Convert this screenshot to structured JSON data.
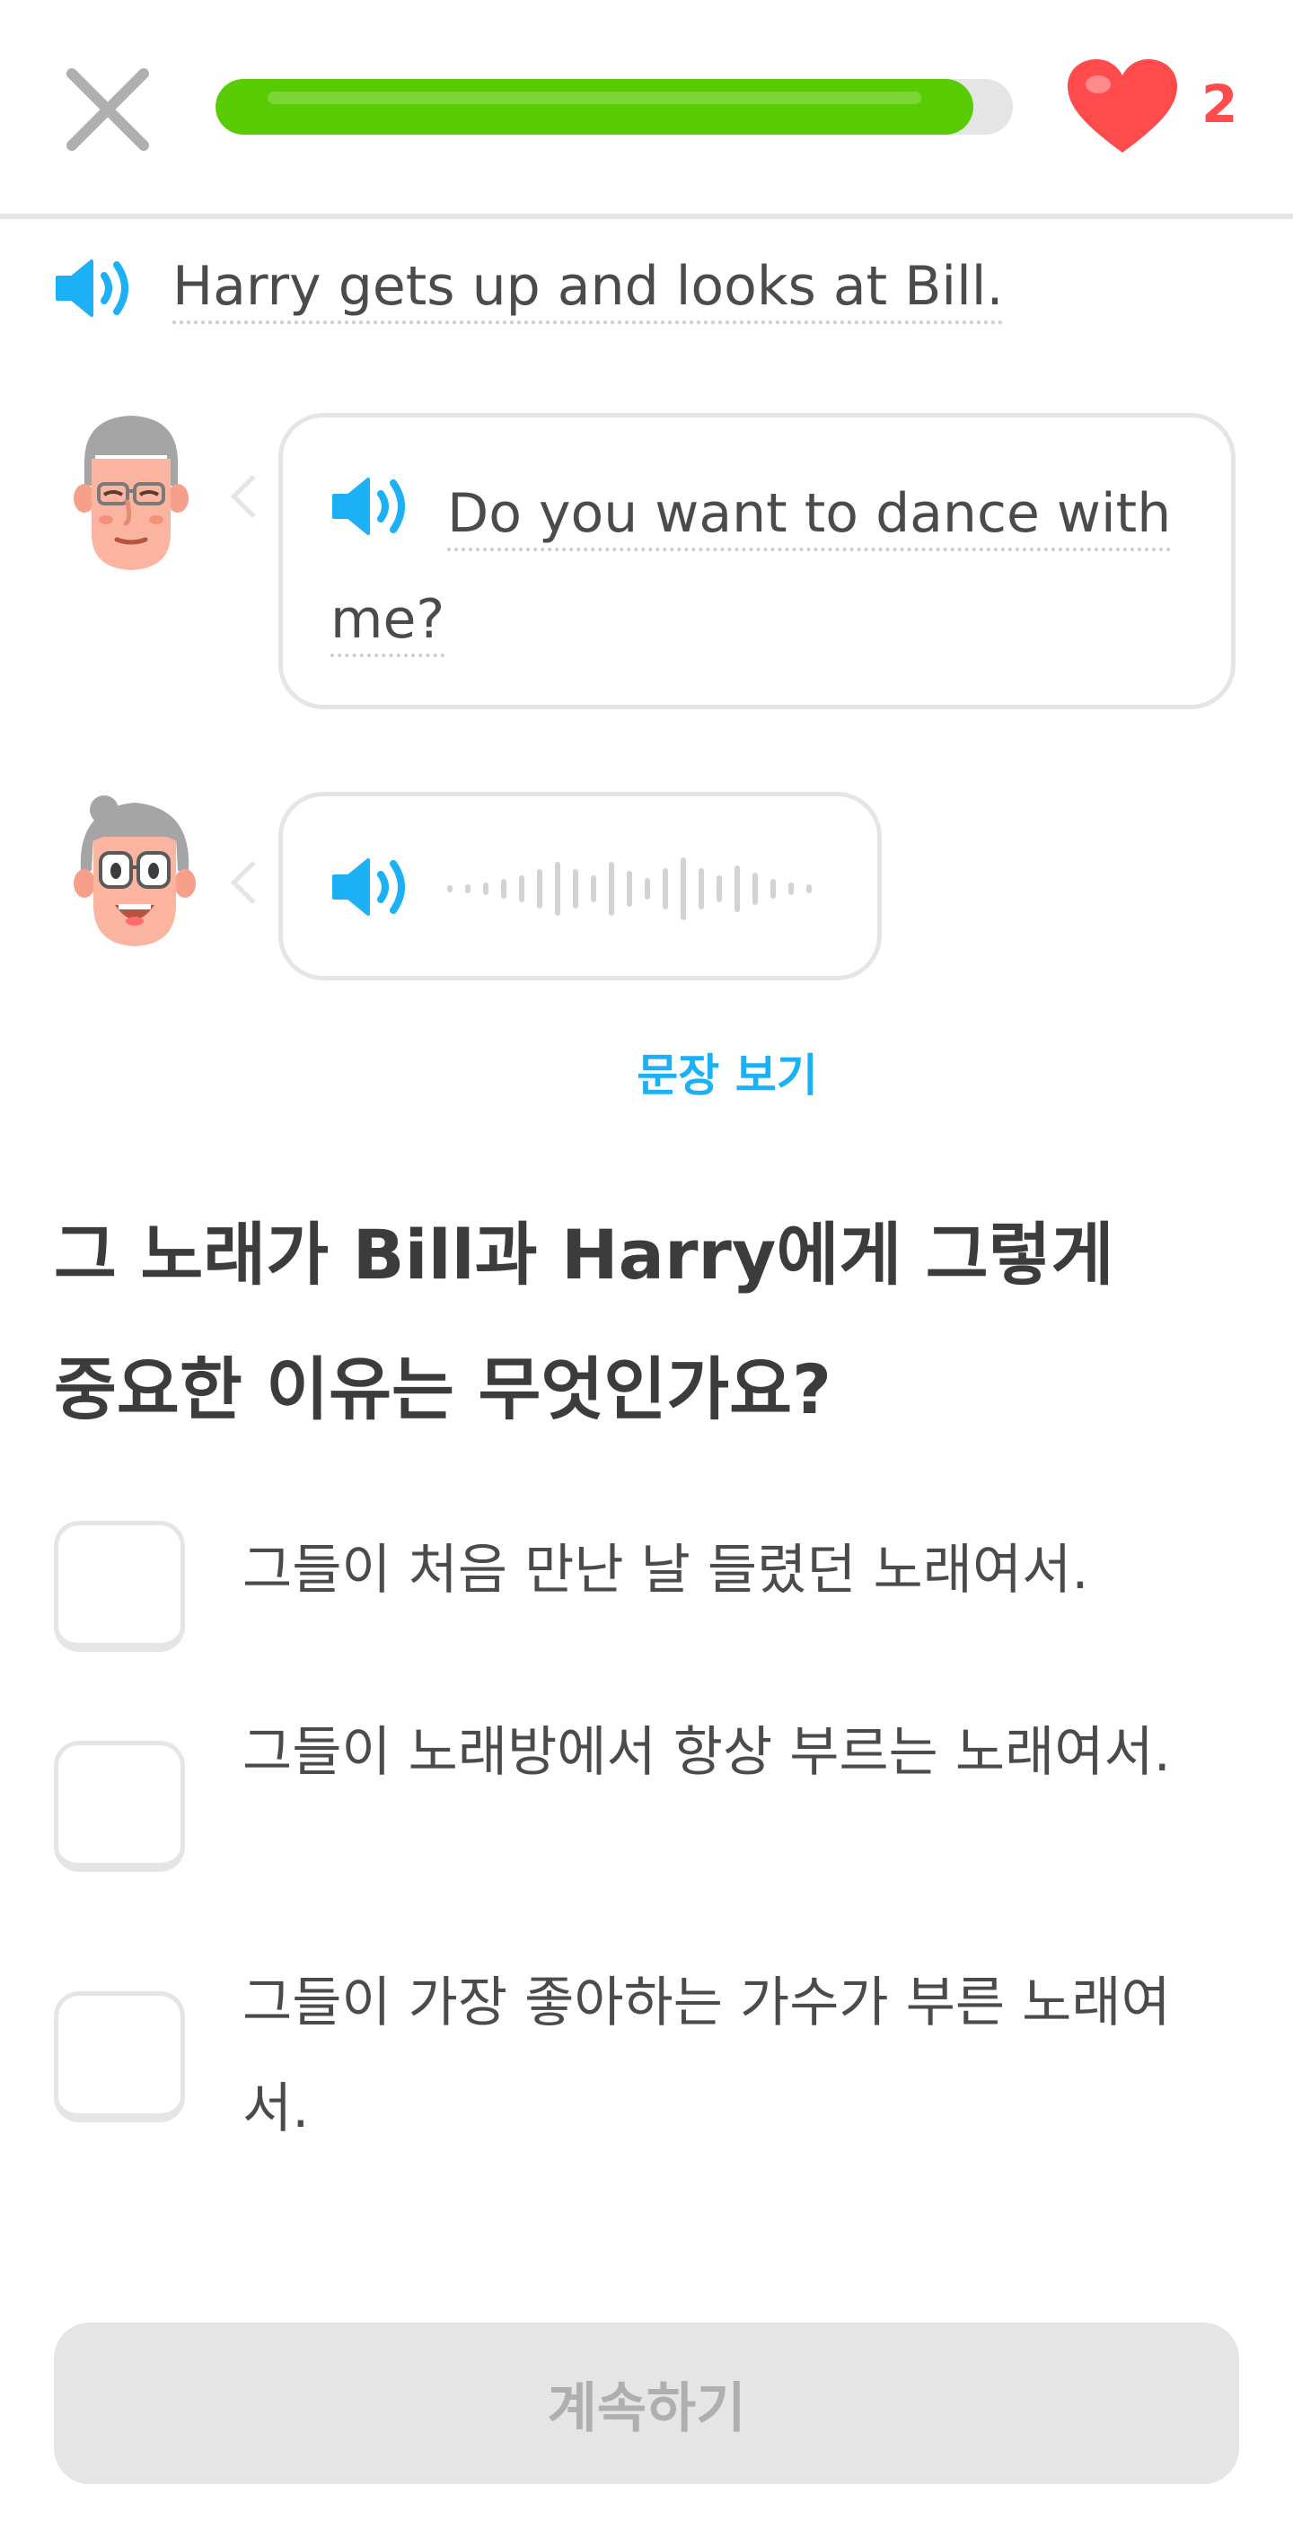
{
  "header": {
    "close_icon": "close-icon",
    "progress_fraction": 0.95,
    "heart_icon": "heart-icon",
    "hearts_count": "2",
    "colors": {
      "progress": "#58cc02",
      "hearts": "#ff4b4b"
    }
  },
  "narration": {
    "speaker_icon": "speaker-icon",
    "text": "Harry gets up and looks at Bill."
  },
  "dialogue": [
    {
      "avatar": "bill-avatar",
      "speaker_icon": "speaker-icon",
      "text": "Do you want to dance with me?"
    },
    {
      "avatar": "harry-avatar",
      "speaker_icon": "speaker-icon",
      "waveform_icon": "audio-waveform-icon"
    }
  ],
  "see_sentence_label": "문장 보기",
  "question": {
    "line1": "그 노래가 Bill과 Harry에게 그렇게",
    "line2": "중요한 이유는 무엇인가요?"
  },
  "options": [
    {
      "text": "그들이 처음 만난 날 들렸던 노래여서."
    },
    {
      "text": "그들이 노래방에서 항상 부르는 노래여서."
    },
    {
      "text": "그들이 가장 좋아하는 가수가 부른 노래여서."
    }
  ],
  "continue_label": "계속하기"
}
